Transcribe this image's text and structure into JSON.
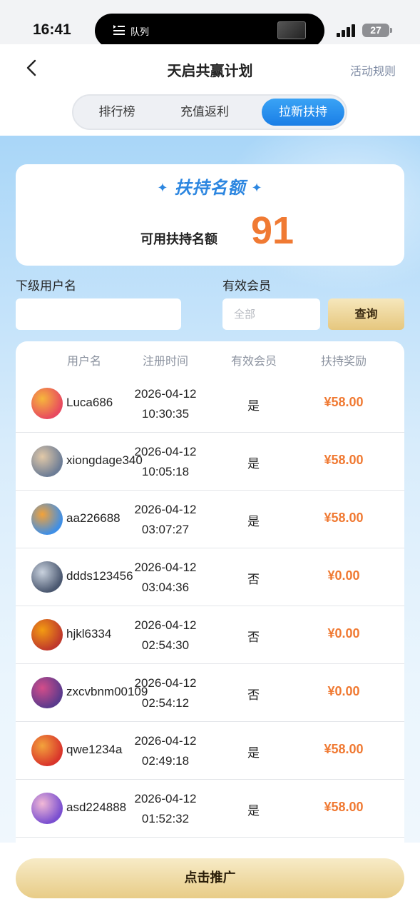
{
  "status": {
    "time": "16:41",
    "island_label": "队列",
    "battery": "27"
  },
  "nav": {
    "title": "天启共赢计划",
    "rules": "活动规则"
  },
  "tabs": [
    {
      "label": "排行榜",
      "active": false
    },
    {
      "label": "充值返利",
      "active": false
    },
    {
      "label": "拉新扶持",
      "active": true
    }
  ],
  "quota": {
    "heading": "扶持名额",
    "label": "可用扶持名额",
    "value": "91"
  },
  "filters": {
    "username_label": "下级用户名",
    "username_value": "",
    "member_label": "有效会员",
    "member_value": "全部",
    "query_label": "查询"
  },
  "table": {
    "headers": [
      "用户名",
      "注册时间",
      "有效会员",
      "扶持奖励"
    ],
    "rows": [
      {
        "username": "Luca686",
        "date": "2026-04-12",
        "time": "10:30:35",
        "valid": "是",
        "reward": "¥58.00",
        "avatar_colors": [
          "#e84a5f",
          "#f6b73c"
        ]
      },
      {
        "username": "xiongdage340",
        "date": "2026-04-12",
        "time": "10:05:18",
        "valid": "是",
        "reward": "¥58.00",
        "avatar_colors": [
          "#6d7d96",
          "#e2c9a8"
        ]
      },
      {
        "username": "aa226688",
        "date": "2026-04-12",
        "time": "03:07:27",
        "valid": "是",
        "reward": "¥58.00",
        "avatar_colors": [
          "#3f8fe6",
          "#f4a238"
        ]
      },
      {
        "username": "ddds123456",
        "date": "2026-04-12",
        "time": "03:04:36",
        "valid": "否",
        "reward": "¥0.00",
        "avatar_colors": [
          "#4b5870",
          "#c9d2de"
        ]
      },
      {
        "username": "hjkl6334",
        "date": "2026-04-12",
        "time": "02:54:30",
        "valid": "否",
        "reward": "¥0.00",
        "avatar_colors": [
          "#c0392b",
          "#f39c12"
        ]
      },
      {
        "username": "zxcvbnm00109",
        "date": "2026-04-12",
        "time": "02:54:12",
        "valid": "否",
        "reward": "¥0.00",
        "avatar_colors": [
          "#5b3a8c",
          "#d44d8a"
        ]
      },
      {
        "username": "qwe1234a",
        "date": "2026-04-12",
        "time": "02:49:18",
        "valid": "是",
        "reward": "¥58.00",
        "avatar_colors": [
          "#d9352b",
          "#f3a33c"
        ]
      },
      {
        "username": "asd224888",
        "date": "2026-04-12",
        "time": "01:52:32",
        "valid": "是",
        "reward": "¥58.00",
        "avatar_colors": [
          "#7a4fd0",
          "#f2b9d6"
        ]
      }
    ]
  },
  "footer": {
    "promote_label": "点击推广"
  },
  "colors": {
    "accent_blue": "#1a7ee6",
    "reward_orange": "#f07a33",
    "gold": "#e6c77e"
  }
}
